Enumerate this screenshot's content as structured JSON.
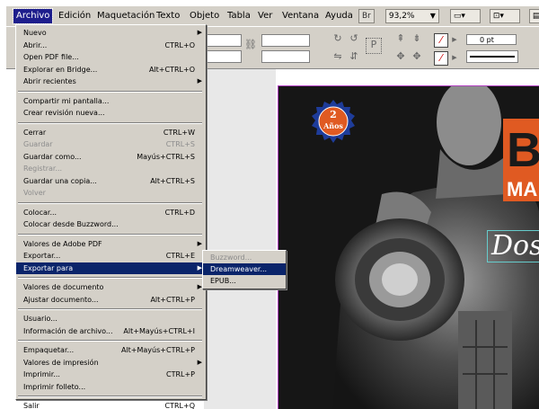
{
  "menubar": {
    "items": [
      "Archivo",
      "Edición",
      "Maquetación",
      "Texto",
      "Objeto",
      "Tabla",
      "Ver",
      "Ventana",
      "Ayuda"
    ],
    "br_label": "Br",
    "zoom": "93,2%"
  },
  "control_panel": {
    "stroke_weight": "0 pt",
    "corner_label": "P"
  },
  "file_menu": {
    "items": [
      {
        "label": "Nuevo",
        "shortcut": "",
        "submenu": true,
        "disabled": false
      },
      {
        "label": "Abrir...",
        "shortcut": "CTRL+O",
        "submenu": false,
        "disabled": false
      },
      {
        "label": "Open PDF file...",
        "shortcut": "",
        "submenu": false,
        "disabled": false
      },
      {
        "label": "Explorar en Bridge...",
        "shortcut": "Alt+CTRL+O",
        "submenu": false,
        "disabled": false
      },
      {
        "label": "Abrir recientes",
        "shortcut": "",
        "submenu": true,
        "disabled": false
      },
      {
        "label": "Compartir mi pantalla...",
        "shortcut": "",
        "submenu": false,
        "disabled": false
      },
      {
        "label": "Crear revisión nueva...",
        "shortcut": "",
        "submenu": false,
        "disabled": false
      },
      {
        "label": "Cerrar",
        "shortcut": "CTRL+W",
        "submenu": false,
        "disabled": false
      },
      {
        "label": "Guardar",
        "shortcut": "CTRL+S",
        "submenu": false,
        "disabled": true
      },
      {
        "label": "Guardar como...",
        "shortcut": "Mayús+CTRL+S",
        "submenu": false,
        "disabled": false
      },
      {
        "label": "Registrar...",
        "shortcut": "",
        "submenu": false,
        "disabled": true
      },
      {
        "label": "Guardar una copia...",
        "shortcut": "Alt+CTRL+S",
        "submenu": false,
        "disabled": false
      },
      {
        "label": "Volver",
        "shortcut": "",
        "submenu": false,
        "disabled": true
      },
      {
        "label": "Colocar...",
        "shortcut": "CTRL+D",
        "submenu": false,
        "disabled": false
      },
      {
        "label": "Colocar desde Buzzword...",
        "shortcut": "",
        "submenu": false,
        "disabled": false
      },
      {
        "label": "Valores de Adobe PDF",
        "shortcut": "",
        "submenu": true,
        "disabled": false
      },
      {
        "label": "Exportar...",
        "shortcut": "CTRL+E",
        "submenu": false,
        "disabled": false
      },
      {
        "label": "Exportar para",
        "shortcut": "",
        "submenu": true,
        "disabled": false,
        "highlighted": true
      },
      {
        "label": "Valores de documento",
        "shortcut": "",
        "submenu": true,
        "disabled": false
      },
      {
        "label": "Ajustar documento...",
        "shortcut": "Alt+CTRL+P",
        "submenu": false,
        "disabled": false
      },
      {
        "label": "Usuario...",
        "shortcut": "",
        "submenu": false,
        "disabled": false
      },
      {
        "label": "Información de archivo...",
        "shortcut": "Alt+Mayús+CTRL+I",
        "submenu": false,
        "disabled": false
      },
      {
        "label": "Empaquetar...",
        "shortcut": "Alt+Mayús+CTRL+P",
        "submenu": false,
        "disabled": false
      },
      {
        "label": "Valores de impresión",
        "shortcut": "",
        "submenu": true,
        "disabled": false
      },
      {
        "label": "Imprimir...",
        "shortcut": "CTRL+P",
        "submenu": false,
        "disabled": false
      },
      {
        "label": "Imprimir folleto...",
        "shortcut": "",
        "submenu": false,
        "disabled": false
      },
      {
        "label": "Salir",
        "shortcut": "CTRL+Q",
        "submenu": false,
        "disabled": false
      }
    ]
  },
  "export_submenu": {
    "items": [
      {
        "label": "Buzzword...",
        "disabled": true
      },
      {
        "label": "Dreamweaver...",
        "highlighted": true
      },
      {
        "label": "EPUB..."
      }
    ]
  },
  "poster": {
    "badge_line1": "2",
    "badge_line2": "Años",
    "title_big": "B",
    "title_small": "MA",
    "subtitle": "Dos"
  },
  "colors": {
    "menu_bg": "#d4d0c8",
    "highlight": "#0a246a",
    "accent_orange": "#e05a22",
    "frame_purple": "#b040c0"
  }
}
